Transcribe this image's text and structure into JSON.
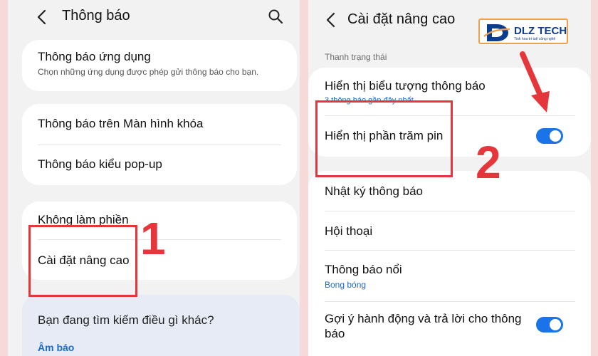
{
  "left_screen": {
    "title": "Thông báo",
    "app_notifications": {
      "title": "Thông báo ứng dụng",
      "subtitle": "Chọn những ứng dụng được phép gửi thông báo cho bạn."
    },
    "lock_screen": "Thông báo trên Màn hình khóa",
    "popup": "Thông báo kiểu pop-up",
    "dnd": "Không làm phiền",
    "advanced": "Cài đặt nâng cao",
    "hint": {
      "title": "Bạn đang tìm kiếm điều gì khác?",
      "link": "Âm báo"
    },
    "step_number": "1"
  },
  "right_screen": {
    "title": "Cài đặt nâng cao",
    "section_status_bar": "Thanh trạng thái",
    "show_icons": {
      "title": "Hiển thị biểu tượng thông báo",
      "subtitle": "3 thông báo gần đây nhất"
    },
    "battery_percent": {
      "title": "Hiển thị phần trăm pin",
      "enabled": true
    },
    "notification_history": "Nhật ký thông báo",
    "conversations": "Hội thoại",
    "floating": {
      "title": "Thông báo nổi",
      "subtitle": "Bong bóng"
    },
    "suggested_actions": {
      "title": "Gợi ý hành động và trả lời cho thông báo",
      "enabled": true
    },
    "step_number": "2"
  },
  "watermark": {
    "brand": "DLZ TECH",
    "tagline": "Tinh hoa trí tuệ công nghệ"
  },
  "colors": {
    "highlight": "#e5373b",
    "toggle_on": "#1a73e8",
    "link": "#1a6bd0"
  }
}
